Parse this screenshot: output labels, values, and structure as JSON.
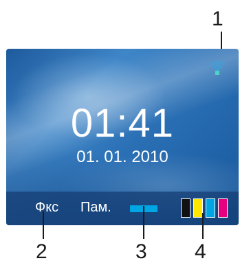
{
  "callouts": {
    "one": "1",
    "two": "2",
    "three": "3",
    "four": "4"
  },
  "screen": {
    "time": "01:41",
    "date": "01. 01. 2010",
    "wifi_icon": "wifi-signal-icon",
    "wifi_color": "#3aa0d8"
  },
  "bottom_bar": {
    "fax_label": "Фкс",
    "memory_label": "Пам.",
    "status_bar_color": "#00a6e3",
    "ink_icon": "ink-level-icon",
    "ink_colors": [
      "#111111",
      "#ffe600",
      "#00a6e3",
      "#e6007e"
    ]
  }
}
